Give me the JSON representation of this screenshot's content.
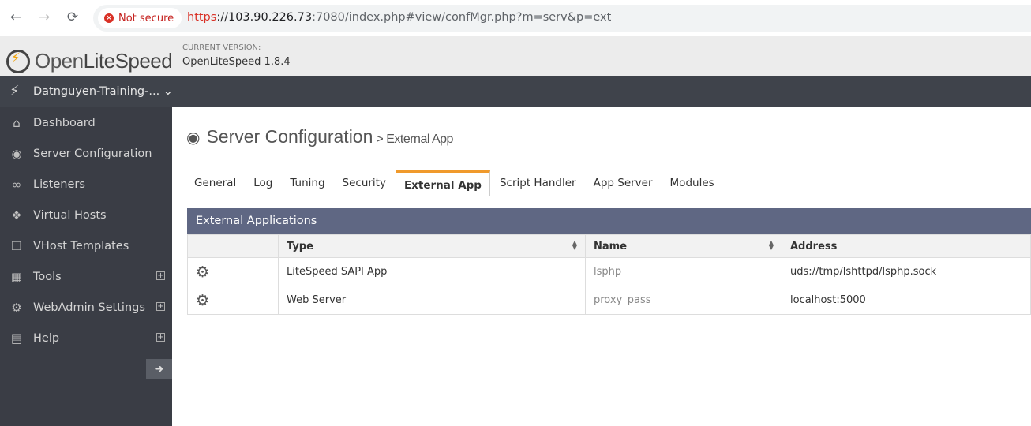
{
  "browser": {
    "nav": {
      "back": "←",
      "forward": "→",
      "reload": "⟳"
    },
    "security": "Not secure",
    "url_scheme": "https",
    "url_host": "://103.90.226.73",
    "url_rest": ":7080/index.php#view/confMgr.php?m=serv&p=ext"
  },
  "header": {
    "logo_open": "Open",
    "logo_brand": "LiteSpeed",
    "version_label": "CURRENT VERSION:",
    "version_value": "OpenLiteSpeed 1.8.4"
  },
  "server_selector": {
    "name": "Datnguyen-Training-... ⌄"
  },
  "sidebar": {
    "items": [
      {
        "label": "Dashboard",
        "icon": "home-icon",
        "expand": false
      },
      {
        "label": "Server Configuration",
        "icon": "globe-icon",
        "expand": false
      },
      {
        "label": "Listeners",
        "icon": "link-icon",
        "expand": false
      },
      {
        "label": "Virtual Hosts",
        "icon": "cubes-icon",
        "expand": false
      },
      {
        "label": "VHost Templates",
        "icon": "copy-icon",
        "expand": false
      },
      {
        "label": "Tools",
        "icon": "grid-icon",
        "expand": true
      },
      {
        "label": "WebAdmin Settings",
        "icon": "gear-icon",
        "expand": true
      },
      {
        "label": "Help",
        "icon": "book-icon",
        "expand": true
      }
    ]
  },
  "main": {
    "title": "Server Configuration",
    "subtitle": "> External App",
    "tabs": [
      {
        "label": "General",
        "active": false
      },
      {
        "label": "Log",
        "active": false
      },
      {
        "label": "Tuning",
        "active": false
      },
      {
        "label": "Security",
        "active": false
      },
      {
        "label": "External App",
        "active": true
      },
      {
        "label": "Script Handler",
        "active": false
      },
      {
        "label": "App Server",
        "active": false
      },
      {
        "label": "Modules",
        "active": false
      }
    ],
    "panel_title": "External Applications",
    "columns": [
      "",
      "Type",
      "Name",
      "Address"
    ],
    "rows": [
      {
        "type": "LiteSpeed SAPI App",
        "name": "lsphp",
        "address": "uds://tmp/lshttpd/lsphp.sock"
      },
      {
        "type": "Web Server",
        "name": "proxy_pass",
        "address": "localhost:5000"
      }
    ]
  },
  "colors": {
    "accent": "#f09a2c",
    "sidebar_bg": "#3a3d45",
    "panel_head": "#5f6783"
  }
}
